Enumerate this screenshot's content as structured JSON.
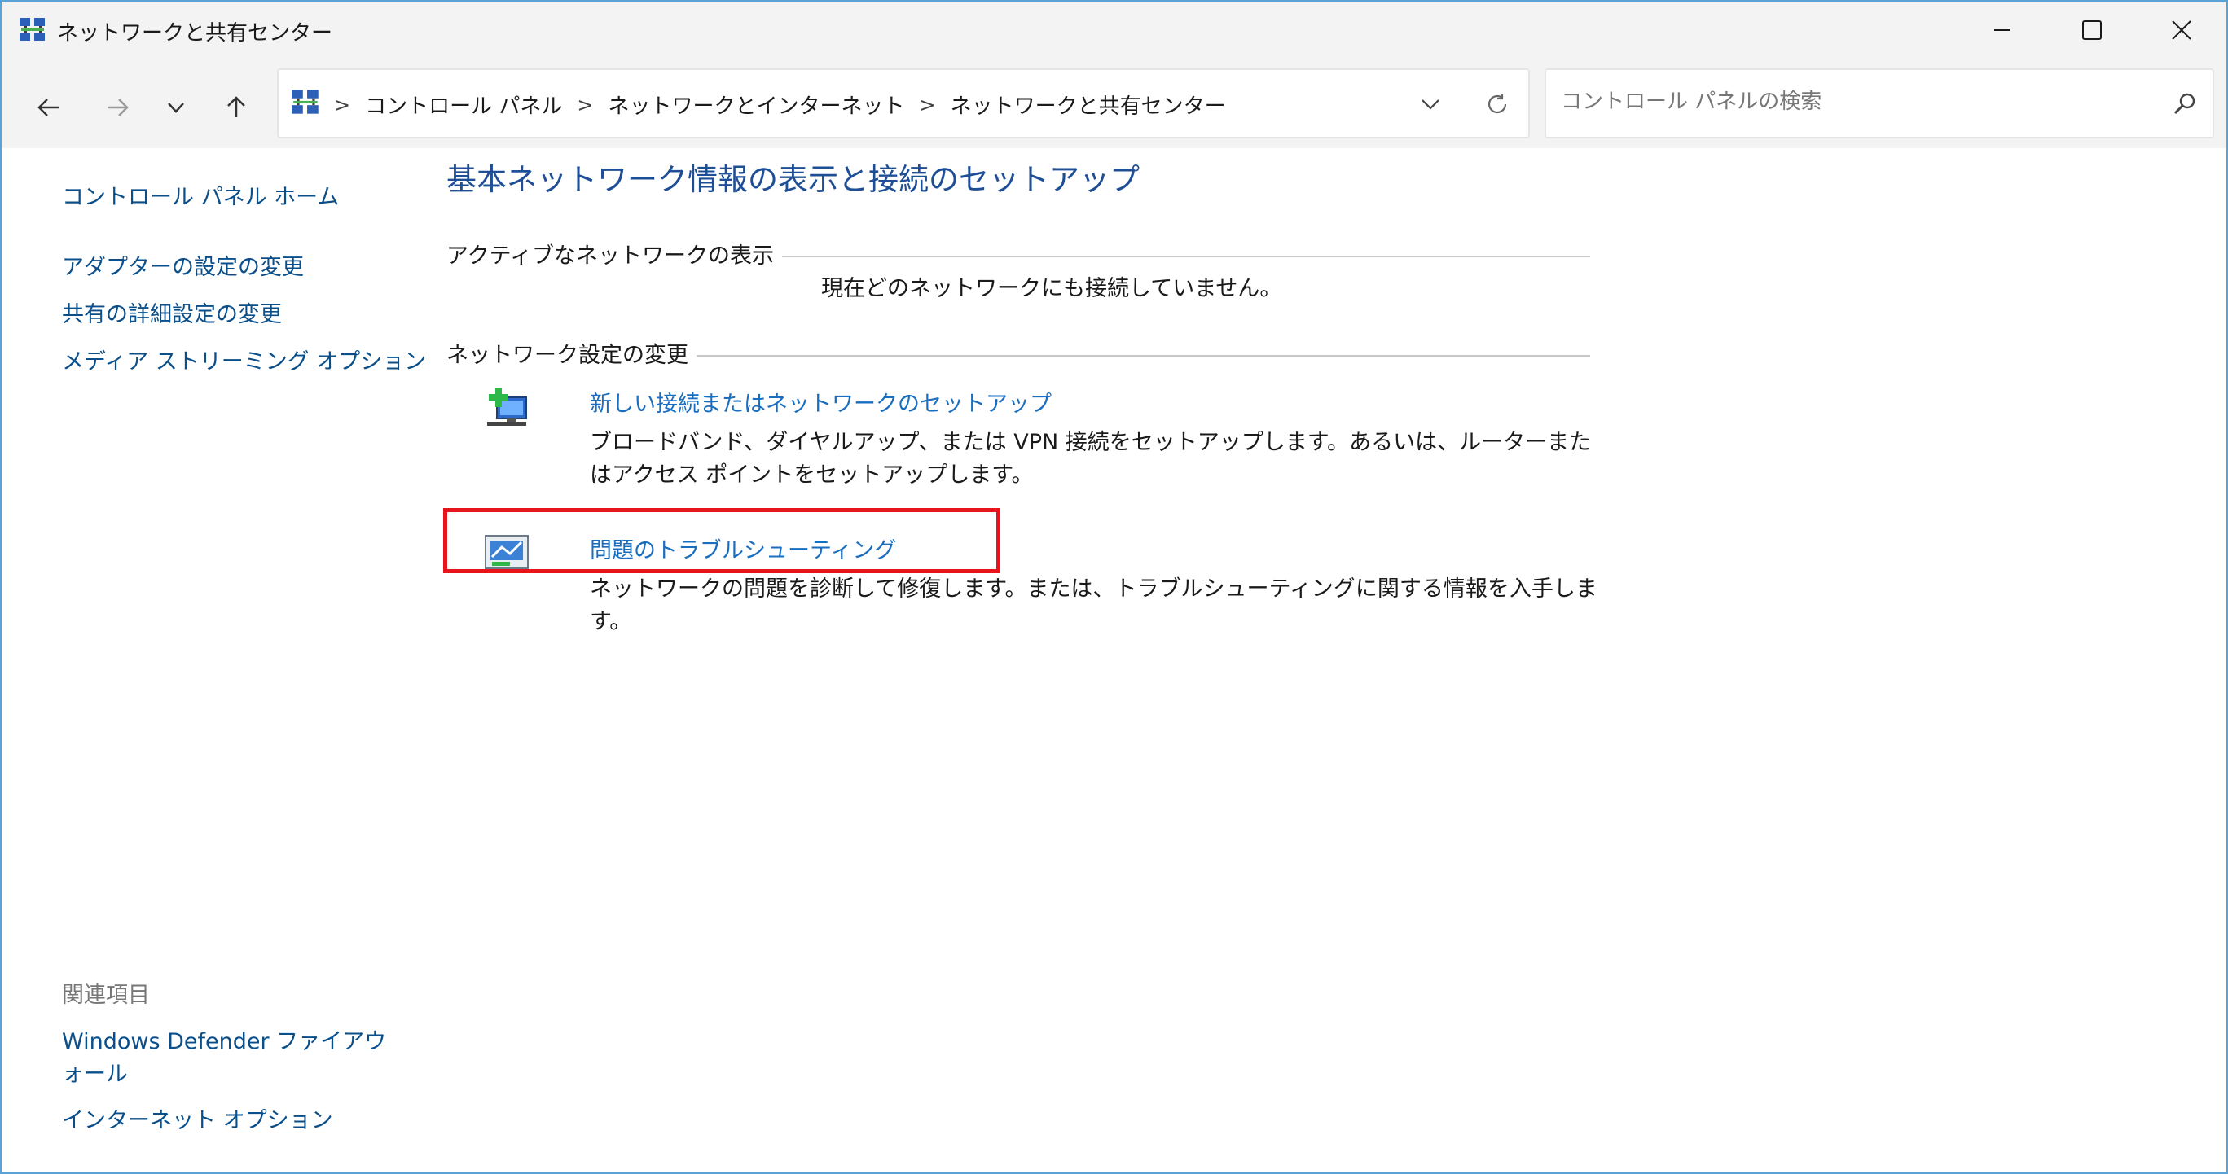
{
  "window": {
    "title": "ネットワークと共有センター"
  },
  "nav": {
    "breadcrumb": [
      "コントロール パネル",
      "ネットワークとインターネット",
      "ネットワークと共有センター"
    ],
    "search_placeholder": "コントロール パネルの検索"
  },
  "sidebar": {
    "home": "コントロール パネル ホーム",
    "adapter": "アダプターの設定の変更",
    "sharing": "共有の詳細設定の変更",
    "media": "メディア ストリーミング オプション",
    "related_title": "関連項目",
    "defender": "Windows Defender ファイアウォール",
    "internet_options": "インターネット オプション"
  },
  "main": {
    "title": "基本ネットワーク情報の表示と接続のセットアップ",
    "active_section": "アクティブなネットワークの表示",
    "no_network": "現在どのネットワークにも接続していません。",
    "change_section": "ネットワーク設定の変更",
    "tasks": [
      {
        "label": "新しい接続またはネットワークのセットアップ",
        "description": "ブロードバンド、ダイヤルアップ、または VPN 接続をセットアップします。あるいは、ルーターまたはアクセス ポイントをセットアップします。"
      },
      {
        "label": "問題のトラブルシューティング",
        "description": "ネットワークの問題を診断して修復します。または、トラブルシューティングに関する情報を入手します。"
      }
    ]
  },
  "colors": {
    "link": "#0b4f8a",
    "title": "#1e4e96",
    "highlight": "#e8141c",
    "window_border": "#5ba3d6"
  }
}
